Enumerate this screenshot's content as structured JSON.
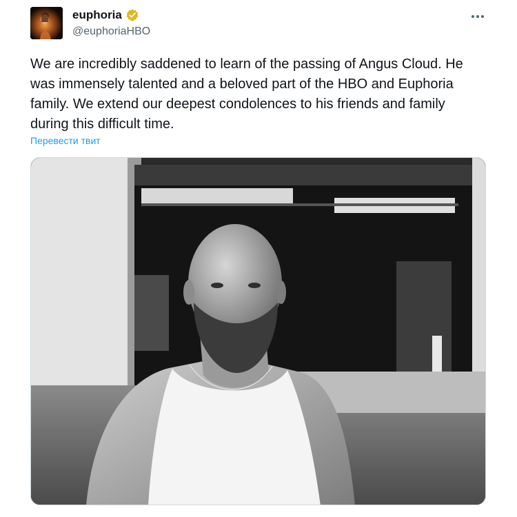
{
  "tweet": {
    "author": {
      "display_name": "euphoria",
      "handle": "@euphoriaHBO",
      "verified_badge_color": "#e2b719",
      "avatar_icon": "profile-avatar"
    },
    "more_icon": "more-horizontal-icon",
    "text": "We are incredibly saddened to learn of the passing of Angus Cloud. He was immensely talented and a beloved part of the HBO and Euphoria family. We extend our deepest condolences to his friends and family during this difficult time.",
    "translate_label": "Перевести твит",
    "media": {
      "kind": "black-and-white photo",
      "icon": "attached-photo"
    }
  },
  "colors": {
    "text": "#0f1419",
    "secondary": "#536471",
    "link": "#1d9bf0",
    "border": "#cfd9de"
  }
}
